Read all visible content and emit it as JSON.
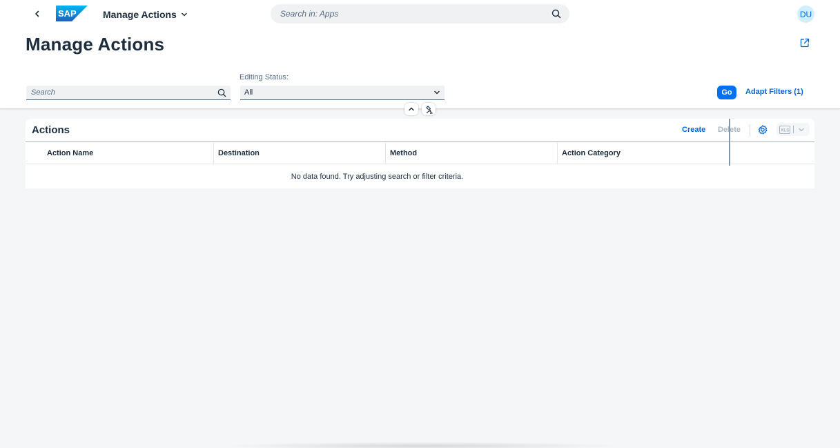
{
  "shell": {
    "app_title": "Manage Actions",
    "search_placeholder": "Search in: Apps",
    "avatar_initials": "DU",
    "logo_text": "SAP"
  },
  "header": {
    "title": "Manage Actions"
  },
  "filters": {
    "search_placeholder": "Search",
    "editing_status_label": "Editing Status:",
    "editing_status_value": "All",
    "go_label": "Go",
    "adapt_filters_label": "Adapt Filters (1)"
  },
  "table": {
    "title": "Actions",
    "create_label": "Create",
    "delete_label": "Delete",
    "export_icon_label": "XLS",
    "columns": [
      "Action Name",
      "Destination",
      "Method",
      "Action Category"
    ],
    "no_data_text": "No data found. Try adjusting search or filter criteria."
  },
  "colors": {
    "accent": "#0070f2",
    "link": "#0064d9",
    "disabled": "#a7b6c5",
    "background": "#f5f6f7",
    "text": "#1d2d3e",
    "logo": "#0a6ed1"
  },
  "icons": [
    "back-icon",
    "sap-logo",
    "chevron-down-icon",
    "search-icon",
    "share-icon",
    "collapse-icon",
    "pin-icon",
    "settings-icon",
    "excel-icon"
  ]
}
